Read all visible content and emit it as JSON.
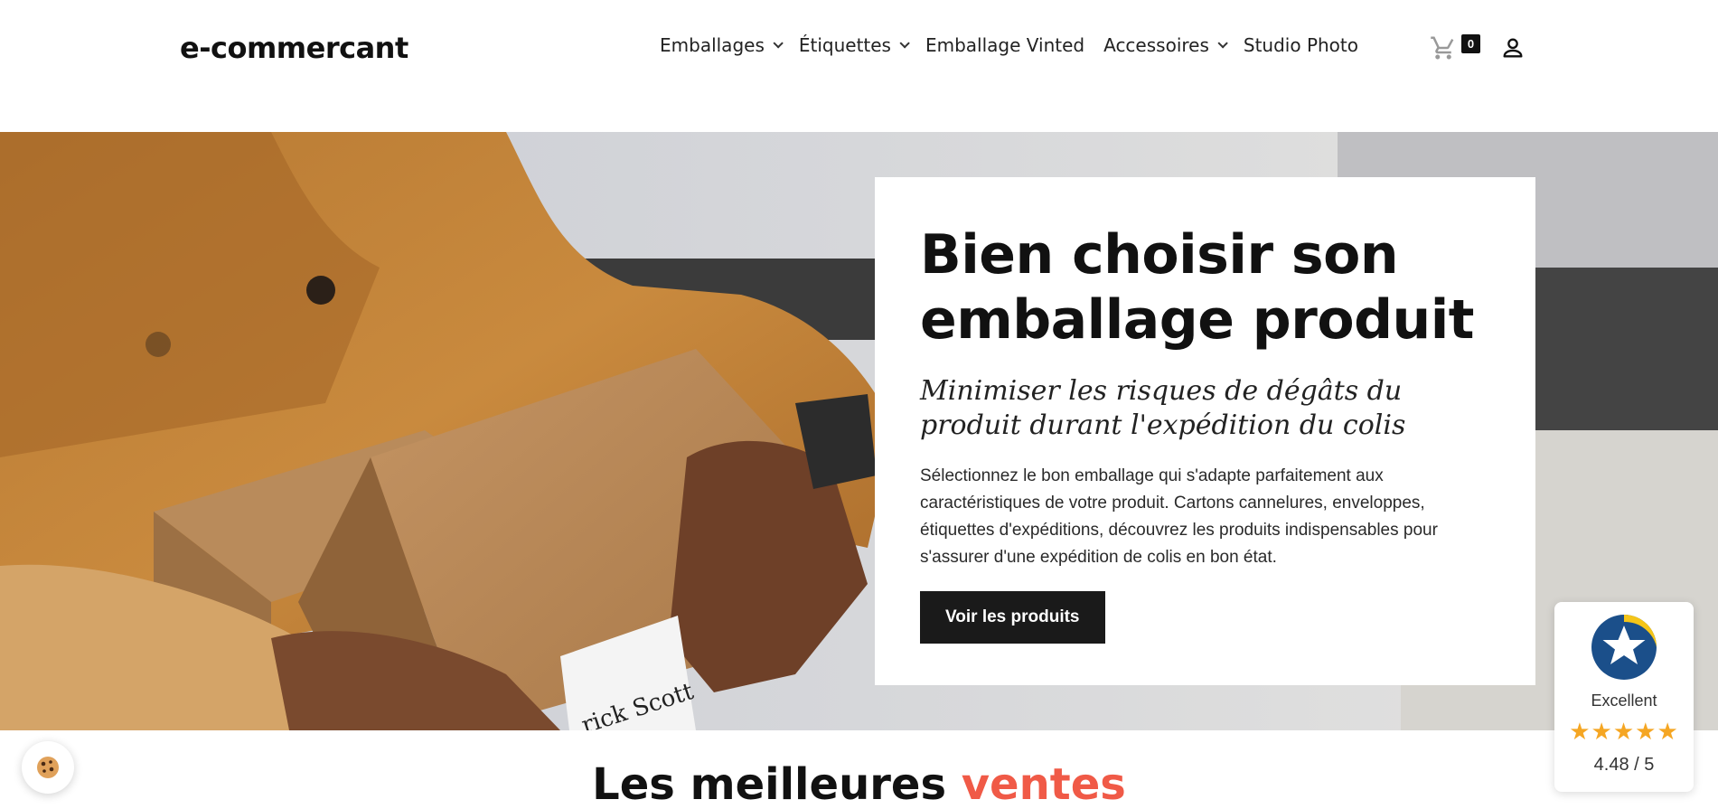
{
  "header": {
    "logo": "e-commercant",
    "nav": [
      {
        "label": "Emballages",
        "has_dropdown": true
      },
      {
        "label": "Étiquettes",
        "has_dropdown": true
      },
      {
        "label": "Emballage Vinted",
        "has_dropdown": false
      },
      {
        "label": "Accessoires",
        "has_dropdown": true
      },
      {
        "label": "Studio Photo",
        "has_dropdown": false
      }
    ],
    "cart_count": "0",
    "icons": {
      "cart": "cart-icon",
      "account": "user-icon"
    }
  },
  "hero": {
    "title": "Bien choisir son emballage produit",
    "subtitle": "Minimiser les risques de dégâts du produit durant l'expédition du colis",
    "description": "Sélectionnez le bon emballage qui s'adapte parfaitement aux caractéristiques de votre produit. Cartons cannelures, enveloppes, étiquettes d'expéditions, découvrez les produits indispensables pour s'assurer d'une expédition de colis en bon état.",
    "button_label": "Voir les produits",
    "image_label": "rick Scott"
  },
  "best_sellers": {
    "title_part1": "Les meilleures",
    "title_part2": "ventes"
  },
  "rating_widget": {
    "label": "Excellent",
    "stars": "★★★★★",
    "score": "4.48 / 5",
    "score_value": 4.48
  },
  "colors": {
    "accent": "#f05a47",
    "button_bg": "#1a1a1a",
    "star": "#f5a623"
  }
}
